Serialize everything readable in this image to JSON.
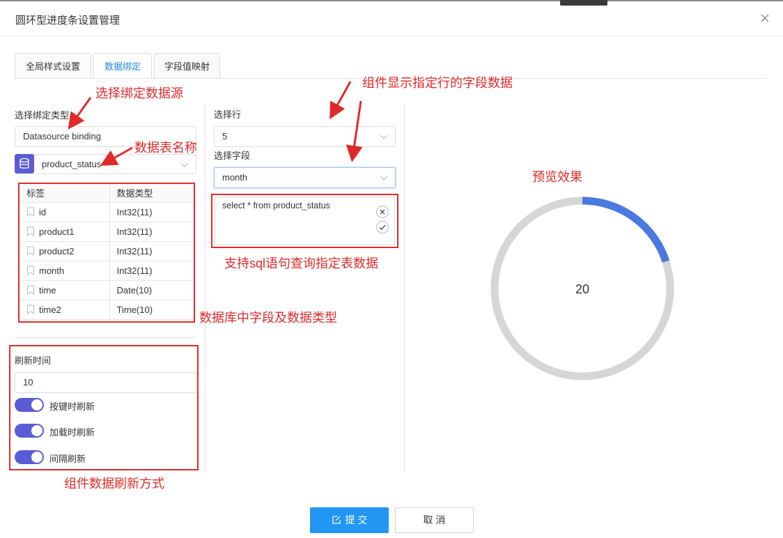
{
  "dialog": {
    "title": "圆环型进度条设置管理"
  },
  "tabs": [
    {
      "label": "全局样式设置",
      "active": false
    },
    {
      "label": "数据绑定",
      "active": true
    },
    {
      "label": "字段值映射",
      "active": false
    }
  ],
  "binding": {
    "type_label": "选择绑定类型",
    "type_value": "Datasource binding",
    "datasource_icon": "database-icon",
    "table_name": "product_status"
  },
  "field_table": {
    "headers": [
      "标签",
      "数据类型"
    ],
    "rows": [
      {
        "name": "id",
        "type": "Int32(11)"
      },
      {
        "name": "product1",
        "type": "Int32(11)"
      },
      {
        "name": "product2",
        "type": "Int32(11)"
      },
      {
        "name": "month",
        "type": "Int32(11)"
      },
      {
        "name": "time",
        "type": "Date(10)"
      },
      {
        "name": "time2",
        "type": "Time(10)"
      }
    ]
  },
  "refresh": {
    "label": "刷新时间",
    "value": "10",
    "options": [
      {
        "label": "按键时刷新",
        "on": true
      },
      {
        "label": "加载时刷新",
        "on": true
      },
      {
        "label": "间隔刷新",
        "on": true
      }
    ]
  },
  "row_select": {
    "label": "选择行",
    "value": "5"
  },
  "field_select": {
    "label": "选择字段",
    "value": "month"
  },
  "sql": {
    "query": "select * from product_status"
  },
  "preview": {
    "value": "20",
    "progress": 0.2,
    "progress_color": "#4a79e0",
    "track_color": "#d6d6d6"
  },
  "annotations": {
    "data_source": "选择绑定数据源",
    "table_name": "数据表名称",
    "row_field": "组件显示指定行的字段数据",
    "sql": "支持sql语句查询指定表数据",
    "preview": "预览效果",
    "db_fields": "数据库中字段及数据类型",
    "refresh": "组件数据刷新方式"
  },
  "buttons": {
    "submit": "提 交",
    "cancel": "取 消"
  },
  "colors": {
    "accent": "#2196f3",
    "toggle": "#5b5bd6",
    "annotation": "#e02a2a"
  }
}
